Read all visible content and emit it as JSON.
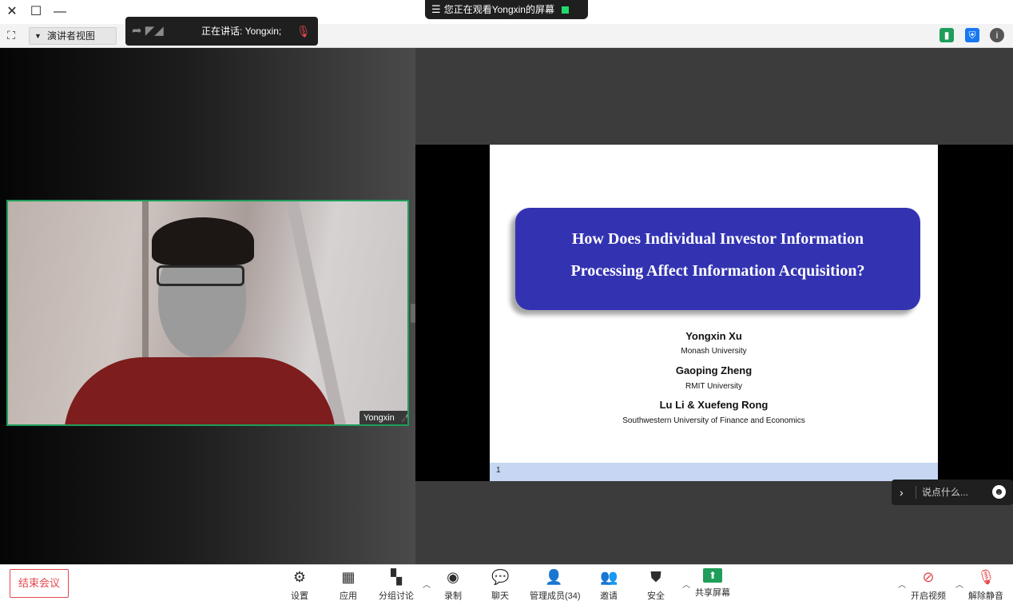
{
  "window": {
    "close_icon": "close-icon",
    "maximize_icon": "maximize-icon",
    "minimize_icon": "minimize-icon",
    "banner_text": "您正在观看Yongxin的屏幕"
  },
  "toolbar2": {
    "view_label": "演讲者视图",
    "speaking_label": "正在讲话: Yongxin;",
    "accent_green": "#1e9e5a",
    "accent_blue": "#1877f2"
  },
  "gallery": {
    "participant_name": "Yongxin"
  },
  "slide": {
    "title_line1": "How Does Individual Investor Information",
    "title_line2": "Processing Affect Information Acquisition?",
    "author1": "Yongxin Xu",
    "aff1": "Monash University",
    "author2": "Gaoping Zheng",
    "aff2": "RMIT University",
    "author3": "Lu Li & Xuefeng Rong",
    "aff3": "Southwestern University of Finance and Economics",
    "page": "1",
    "box_color": "#3333b2"
  },
  "chat": {
    "placeholder": "说点什么..."
  },
  "bottombar": {
    "mute_label": "解除静音",
    "video_label": "开启视频",
    "share_label": "共享屏幕",
    "security_label": "安全",
    "invite_label": "邀请",
    "participants_label": "管理成员(34)",
    "chat_label": "聊天",
    "record_label": "录制",
    "breakout_label": "分组讨论",
    "apps_label": "应用",
    "settings_label": "设置",
    "end_label": "结束会议",
    "end_color": "#e5484d"
  }
}
